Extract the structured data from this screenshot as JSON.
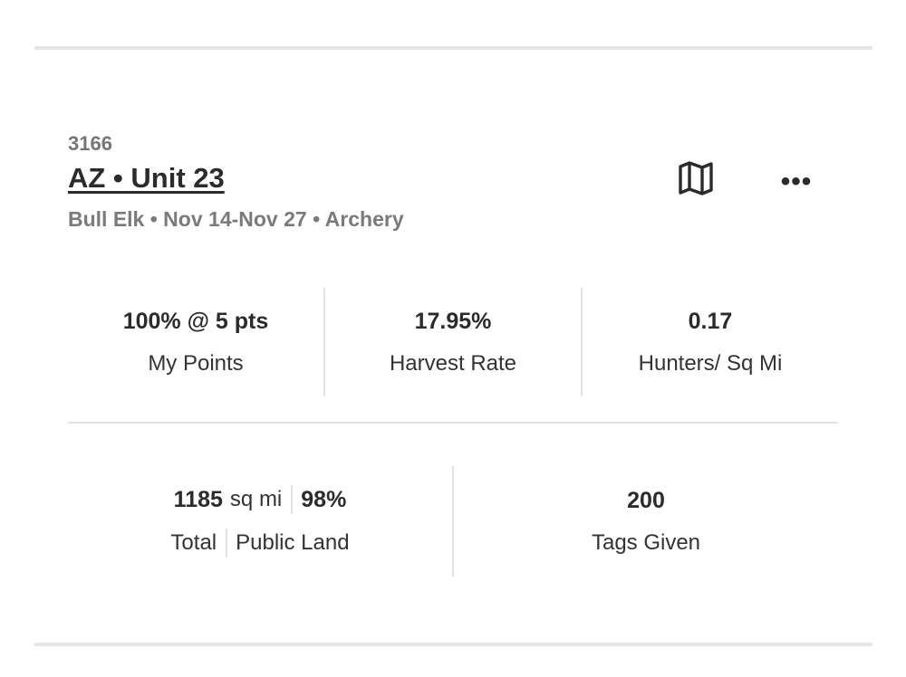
{
  "hunt": {
    "code": "3166",
    "title": "AZ • Unit 23",
    "subtitle": "Bull Elk • Nov 14-Nov 27 • Archery"
  },
  "actions": {
    "map_icon": "map-icon",
    "more_icon": "more-horizontal-icon",
    "more_glyph": "•••"
  },
  "stats_primary": [
    {
      "value": "100% @ 5 pts",
      "label": "My Points"
    },
    {
      "value": "17.95%",
      "label": "Harvest Rate"
    },
    {
      "value": "0.17",
      "label": "Hunters/ Sq Mi"
    }
  ],
  "land": {
    "total_value": "1185",
    "total_unit": "sq mi",
    "public_value": "98%",
    "total_label": "Total",
    "public_label": "Public Land"
  },
  "tags": {
    "value": "200",
    "label": "Tags Given"
  },
  "colors": {
    "divider": "#e3e3e3",
    "muted_text": "#757575",
    "primary_text": "#2b2b2b"
  }
}
